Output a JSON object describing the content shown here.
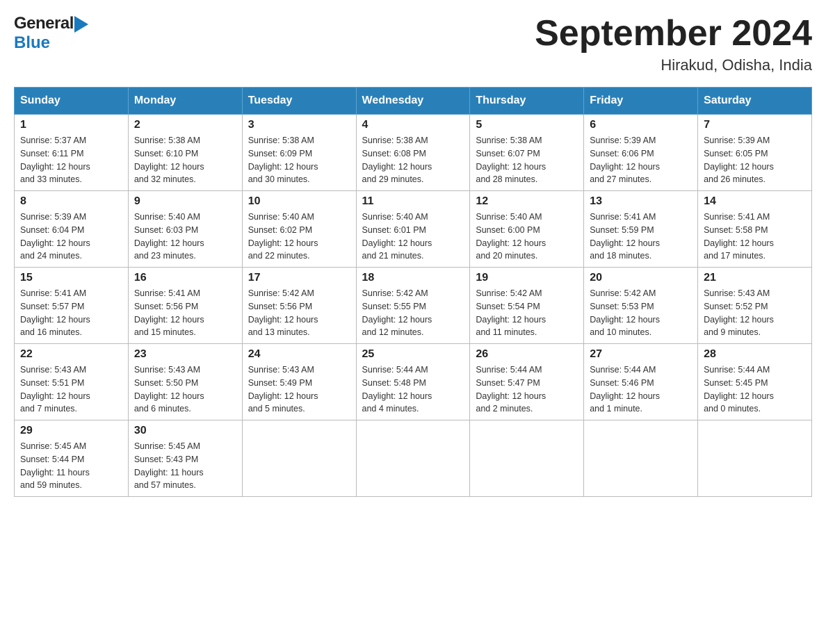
{
  "header": {
    "logo_general": "General",
    "logo_blue": "Blue",
    "title": "September 2024",
    "subtitle": "Hirakud, Odisha, India"
  },
  "calendar": {
    "days_of_week": [
      "Sunday",
      "Monday",
      "Tuesday",
      "Wednesday",
      "Thursday",
      "Friday",
      "Saturday"
    ],
    "weeks": [
      [
        {
          "num": "1",
          "sunrise": "5:37 AM",
          "sunset": "6:11 PM",
          "daylight": "12 hours and 33 minutes."
        },
        {
          "num": "2",
          "sunrise": "5:38 AM",
          "sunset": "6:10 PM",
          "daylight": "12 hours and 32 minutes."
        },
        {
          "num": "3",
          "sunrise": "5:38 AM",
          "sunset": "6:09 PM",
          "daylight": "12 hours and 30 minutes."
        },
        {
          "num": "4",
          "sunrise": "5:38 AM",
          "sunset": "6:08 PM",
          "daylight": "12 hours and 29 minutes."
        },
        {
          "num": "5",
          "sunrise": "5:38 AM",
          "sunset": "6:07 PM",
          "daylight": "12 hours and 28 minutes."
        },
        {
          "num": "6",
          "sunrise": "5:39 AM",
          "sunset": "6:06 PM",
          "daylight": "12 hours and 27 minutes."
        },
        {
          "num": "7",
          "sunrise": "5:39 AM",
          "sunset": "6:05 PM",
          "daylight": "12 hours and 26 minutes."
        }
      ],
      [
        {
          "num": "8",
          "sunrise": "5:39 AM",
          "sunset": "6:04 PM",
          "daylight": "12 hours and 24 minutes."
        },
        {
          "num": "9",
          "sunrise": "5:40 AM",
          "sunset": "6:03 PM",
          "daylight": "12 hours and 23 minutes."
        },
        {
          "num": "10",
          "sunrise": "5:40 AM",
          "sunset": "6:02 PM",
          "daylight": "12 hours and 22 minutes."
        },
        {
          "num": "11",
          "sunrise": "5:40 AM",
          "sunset": "6:01 PM",
          "daylight": "12 hours and 21 minutes."
        },
        {
          "num": "12",
          "sunrise": "5:40 AM",
          "sunset": "6:00 PM",
          "daylight": "12 hours and 20 minutes."
        },
        {
          "num": "13",
          "sunrise": "5:41 AM",
          "sunset": "5:59 PM",
          "daylight": "12 hours and 18 minutes."
        },
        {
          "num": "14",
          "sunrise": "5:41 AM",
          "sunset": "5:58 PM",
          "daylight": "12 hours and 17 minutes."
        }
      ],
      [
        {
          "num": "15",
          "sunrise": "5:41 AM",
          "sunset": "5:57 PM",
          "daylight": "12 hours and 16 minutes."
        },
        {
          "num": "16",
          "sunrise": "5:41 AM",
          "sunset": "5:56 PM",
          "daylight": "12 hours and 15 minutes."
        },
        {
          "num": "17",
          "sunrise": "5:42 AM",
          "sunset": "5:56 PM",
          "daylight": "12 hours and 13 minutes."
        },
        {
          "num": "18",
          "sunrise": "5:42 AM",
          "sunset": "5:55 PM",
          "daylight": "12 hours and 12 minutes."
        },
        {
          "num": "19",
          "sunrise": "5:42 AM",
          "sunset": "5:54 PM",
          "daylight": "12 hours and 11 minutes."
        },
        {
          "num": "20",
          "sunrise": "5:42 AM",
          "sunset": "5:53 PM",
          "daylight": "12 hours and 10 minutes."
        },
        {
          "num": "21",
          "sunrise": "5:43 AM",
          "sunset": "5:52 PM",
          "daylight": "12 hours and 9 minutes."
        }
      ],
      [
        {
          "num": "22",
          "sunrise": "5:43 AM",
          "sunset": "5:51 PM",
          "daylight": "12 hours and 7 minutes."
        },
        {
          "num": "23",
          "sunrise": "5:43 AM",
          "sunset": "5:50 PM",
          "daylight": "12 hours and 6 minutes."
        },
        {
          "num": "24",
          "sunrise": "5:43 AM",
          "sunset": "5:49 PM",
          "daylight": "12 hours and 5 minutes."
        },
        {
          "num": "25",
          "sunrise": "5:44 AM",
          "sunset": "5:48 PM",
          "daylight": "12 hours and 4 minutes."
        },
        {
          "num": "26",
          "sunrise": "5:44 AM",
          "sunset": "5:47 PM",
          "daylight": "12 hours and 2 minutes."
        },
        {
          "num": "27",
          "sunrise": "5:44 AM",
          "sunset": "5:46 PM",
          "daylight": "12 hours and 1 minute."
        },
        {
          "num": "28",
          "sunrise": "5:44 AM",
          "sunset": "5:45 PM",
          "daylight": "12 hours and 0 minutes."
        }
      ],
      [
        {
          "num": "29",
          "sunrise": "5:45 AM",
          "sunset": "5:44 PM",
          "daylight": "11 hours and 59 minutes."
        },
        {
          "num": "30",
          "sunrise": "5:45 AM",
          "sunset": "5:43 PM",
          "daylight": "11 hours and 57 minutes."
        },
        null,
        null,
        null,
        null,
        null
      ]
    ],
    "labels": {
      "sunrise": "Sunrise: ",
      "sunset": "Sunset: ",
      "daylight": "Daylight: "
    }
  }
}
